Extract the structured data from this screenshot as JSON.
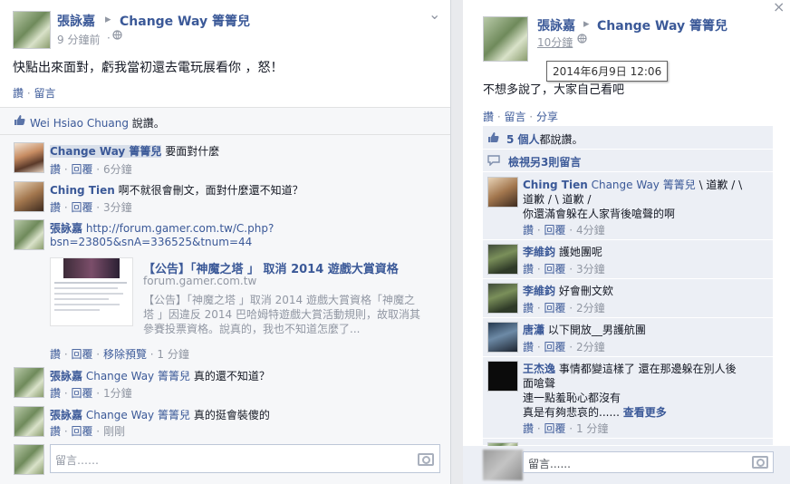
{
  "left": {
    "author": "張詠嘉",
    "arrow": "▸",
    "target": "Change Way 箐箐兒",
    "time": "9 分鐘前",
    "time_sep": " · ",
    "chevron": "⌄",
    "post_text": "快點出來面對，虧我當初還去電玩展看你 ，怒！",
    "actions": {
      "like": "讚",
      "dot": " · ",
      "comment": "留言"
    },
    "like_line": {
      "name": "Wei Hsiao Chuang",
      "suffix": " 說讚。"
    },
    "comments": [
      {
        "name": "Change Way 箐箐兒",
        "text": "要面對什麼",
        "like": "讚",
        "reply": "回覆",
        "time": "6分鐘"
      },
      {
        "name": "Ching Tien",
        "text": "啊不就很會刪文，面對什麼還不知道？",
        "like": "讚",
        "reply": "回覆",
        "time": "3分鐘"
      },
      {
        "name": "張詠嘉",
        "link_line1": "http://forum.gamer.com.tw/C.php?",
        "link_line2": "bsn=23805&snA=336525&tnum=44"
      },
      {
        "name": "張詠嘉",
        "tag": "Change Way 箐箐兒",
        "text": "真的還不知道？",
        "like": "讚",
        "reply": "回覆",
        "time": "1分鐘"
      },
      {
        "name": "張詠嘉",
        "tag": "Change Way 箐箐兒",
        "text": "真的挺會裝傻的",
        "like": "讚",
        "reply": "回覆",
        "time": "剛剛"
      }
    ],
    "preview": {
      "title": "【公告】「神魔之塔 」 取消 2014 遊戲大賞資格",
      "domain": "forum.gamer.com.tw",
      "desc1": "【公告】「神魔之塔 」取消 2014 遊戲大賞資格「神魔之",
      "desc2": "塔 」因違反 2014 巴哈姆特遊戲大賞活動規則，故取消其",
      "desc3": "參賽投票資格。說真的，我也不知道怎麼了...",
      "actions": {
        "like": "讚",
        "reply": "回覆",
        "remove": "移除預覽",
        "time": "1 分鐘"
      }
    },
    "input_placeholder": "留言……"
  },
  "right": {
    "close": "×",
    "author": "張詠嘉",
    "arrow": "▸",
    "target": "Change Way 箐箐兒",
    "time": "10分鐘",
    "tooltip": "2014年6月9日 12:06",
    "post_text": "不想多說了，大家自己看吧",
    "actions": {
      "like": "讚",
      "comment": "留言",
      "share": "分享",
      "dot": " · "
    },
    "likes": {
      "count": "5 個人",
      "suffix": "都說讚。"
    },
    "view_more": "檢視另3則留言",
    "comments": [
      {
        "name": "Ching Tien",
        "tag": "Change Way 箐箐兒",
        "line1": "\\ 道歉 / \\",
        "line2": "道歉 / \\ 道歉 /",
        "line3": "你還滿會躲在人家背後嗆聲的啊",
        "like": "讚",
        "reply": "回覆",
        "time": "4分鐘"
      },
      {
        "name": "李維鈞",
        "text": "護她團呢",
        "like": "讚",
        "reply": "回覆",
        "time": "3分鐘"
      },
      {
        "name": "李維鈞",
        "text": "好會刪文欸",
        "like": "讚",
        "reply": "回覆",
        "time": "2分鐘"
      },
      {
        "name": "唐瀟",
        "text": "以下開放__男護航團",
        "like": "讚",
        "reply": "回覆",
        "time": "2分鐘"
      },
      {
        "name": "王杰逸",
        "line1": "事情都變這樣了 還在那邊躲在別人後",
        "line2": "面嗆聲",
        "line3": "連一點羞恥心都沒有",
        "line4": "真是有夠悲哀的......",
        "more": "查看更多",
        "like": "讚",
        "reply": "回覆",
        "time": "1 分鐘"
      }
    ],
    "input_placeholder": "留言......"
  }
}
